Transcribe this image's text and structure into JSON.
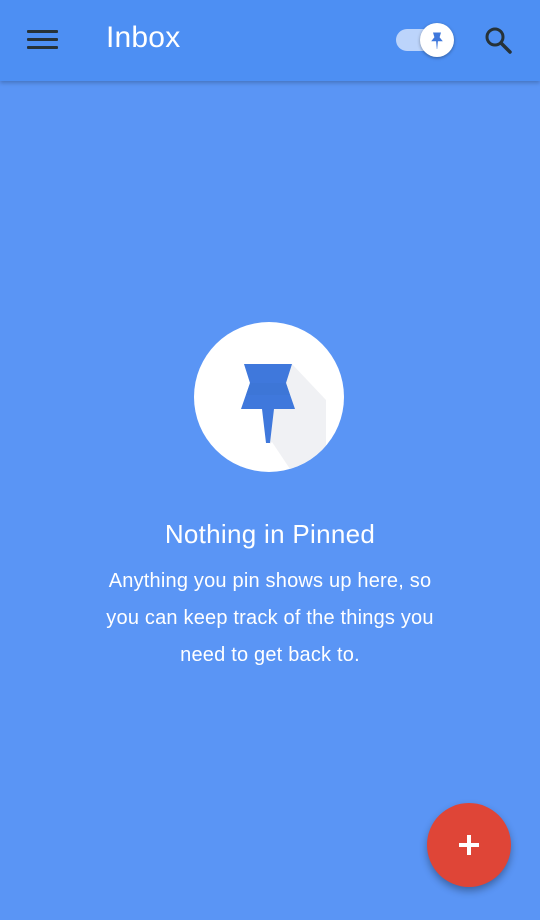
{
  "app_bar": {
    "title": "Inbox",
    "menu_icon": "hamburger-menu-icon",
    "pin_toggle": {
      "state": "on",
      "icon": "pin-icon"
    },
    "search_icon": "search-icon"
  },
  "empty_state": {
    "icon": "pin-icon",
    "title": "Nothing in Pinned",
    "description": "Anything you pin shows up here, so you can keep track of the things you need to get back to."
  },
  "fab": {
    "icon": "plus-icon"
  },
  "colors": {
    "background": "#5a95f5",
    "app_bar": "#4d8ff3",
    "accent": "#3f78dc",
    "fab": "#df4537"
  }
}
